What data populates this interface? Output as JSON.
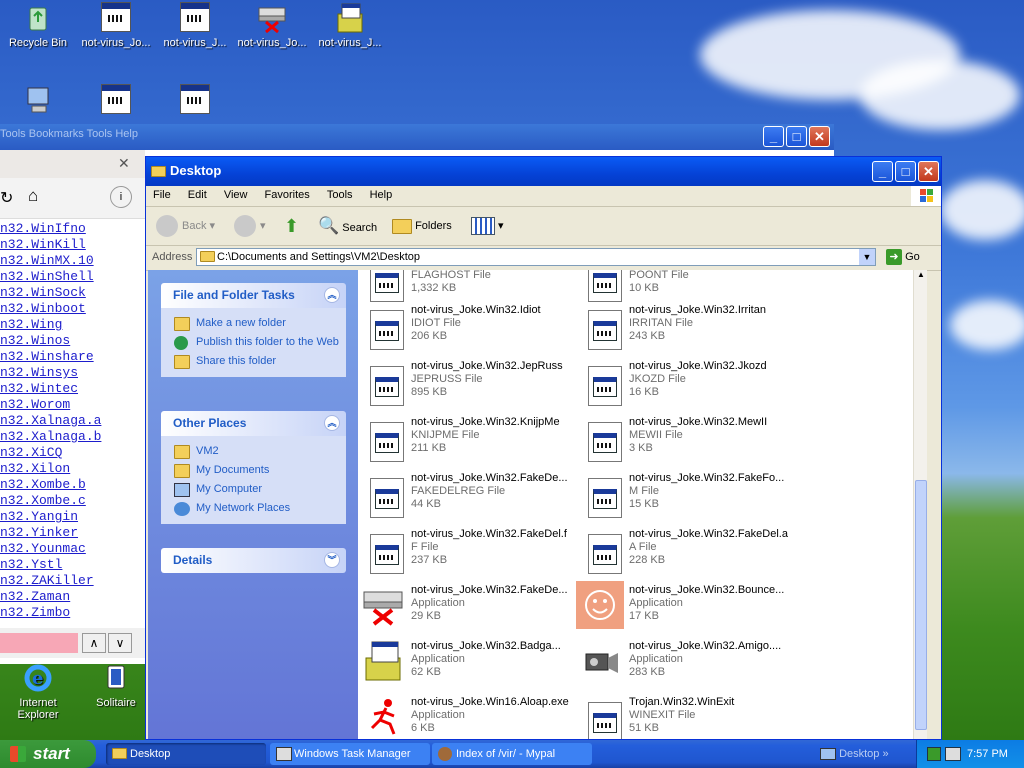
{
  "desktop": {
    "top_icons": [
      {
        "label": "Recycle Bin",
        "icon": "recycle-bin-icon"
      },
      {
        "label": "not-virus_Jo...",
        "icon": "exe-icon"
      },
      {
        "label": "not-virus_J...",
        "icon": "exe-icon"
      },
      {
        "label": "not-virus_Jo...",
        "icon": "network-x-icon"
      },
      {
        "label": "not-virus_J...",
        "icon": "installer-icon"
      }
    ],
    "bottom_icons": [
      {
        "label": "Internet Explorer",
        "icon": "ie-icon"
      },
      {
        "label": "Solitaire",
        "icon": "solitaire-icon"
      }
    ]
  },
  "bg_browser": {
    "faded_menu": "Tools   Bookmarks   Tools   Help",
    "links": [
      "n32.WinIfno",
      "n32.WinKill",
      "n32.WinMX.10",
      "n32.WinShell",
      "n32.WinSock",
      "n32.Winboot",
      "n32.Wing",
      "n32.Winos",
      "n32.Winshare",
      "n32.Winsys",
      "n32.Wintec",
      "n32.Worom",
      "n32.Xalnaga.a",
      "n32.Xalnaga.b",
      "n32.XiCQ",
      "n32.Xilon",
      "n32.Xombe.b",
      "n32.Xombe.c",
      "n32.Yangin",
      "n32.Yinker",
      "n32.Younmac",
      "n32.Ystl",
      "n32.ZAKiller",
      "n32.Zaman",
      "n32.Zimbo"
    ]
  },
  "explorer": {
    "title": "Desktop",
    "menu": [
      "File",
      "Edit",
      "View",
      "Favorites",
      "Tools",
      "Help"
    ],
    "toolbar": {
      "back": "Back",
      "search": "Search",
      "folders": "Folders"
    },
    "address": {
      "label": "Address",
      "path": "C:\\Documents and Settings\\VM2\\Desktop",
      "go": "Go"
    },
    "tasks_panel": {
      "title": "File and Folder Tasks",
      "items": [
        "Make a new folder",
        "Publish this folder to the Web",
        "Share this folder"
      ]
    },
    "places_panel": {
      "title": "Other Places",
      "items": [
        "VM2",
        "My Documents",
        "My Computer",
        "My Network Places"
      ]
    },
    "details_panel": {
      "title": "Details"
    },
    "files": [
      {
        "name": "",
        "type": "FLAGHOST File",
        "size": "1,332 KB",
        "icon": "doc"
      },
      {
        "name": "",
        "type": "POONT File",
        "size": "10 KB",
        "icon": "doc"
      },
      {
        "name": "not-virus_Joke.Win32.Idiot",
        "type": "IDIOT File",
        "size": "206 KB",
        "icon": "doc"
      },
      {
        "name": "not-virus_Joke.Win32.Irritan",
        "type": "IRRITAN File",
        "size": "243 KB",
        "icon": "doc"
      },
      {
        "name": "not-virus_Joke.Win32.JepRuss",
        "type": "JEPRUSS File",
        "size": "895 KB",
        "icon": "doc"
      },
      {
        "name": "not-virus_Joke.Win32.Jkozd",
        "type": "JKOZD File",
        "size": "16 KB",
        "icon": "doc"
      },
      {
        "name": "not-virus_Joke.Win32.KnijpMe",
        "type": "KNIJPME File",
        "size": "211 KB",
        "icon": "doc"
      },
      {
        "name": "not-virus_Joke.Win32.MewII",
        "type": "MEWII File",
        "size": "3 KB",
        "icon": "doc"
      },
      {
        "name": "not-virus_Joke.Win32.FakeDe...",
        "type": "FAKEDELREG File",
        "size": "44 KB",
        "icon": "doc"
      },
      {
        "name": "not-virus_Joke.Win32.FakeFo...",
        "type": "M File",
        "size": "15 KB",
        "icon": "doc"
      },
      {
        "name": "not-virus_Joke.Win32.FakeDel.f",
        "type": "F File",
        "size": "237 KB",
        "icon": "doc"
      },
      {
        "name": "not-virus_Joke.Win32.FakeDel.a",
        "type": "A File",
        "size": "228 KB",
        "icon": "doc"
      },
      {
        "name": "not-virus_Joke.Win32.FakeDe...",
        "type": "Application",
        "size": "29 KB",
        "icon": "network-x"
      },
      {
        "name": "not-virus_Joke.Win32.Bounce...",
        "type": "Application",
        "size": "17 KB",
        "icon": "smiley"
      },
      {
        "name": "not-virus_Joke.Win32.Badga...",
        "type": "Application",
        "size": "62 KB",
        "icon": "installer"
      },
      {
        "name": "not-virus_Joke.Win32.Amigo....",
        "type": "Application",
        "size": "283 KB",
        "icon": "camera"
      },
      {
        "name": "not-virus_Joke.Win16.Aloap.exe",
        "type": "Application",
        "size": "6 KB",
        "icon": "runner"
      },
      {
        "name": "Trojan.Win32.WinExit",
        "type": "WINEXIT File",
        "size": "51 KB",
        "icon": "doc"
      }
    ]
  },
  "taskbar": {
    "start": "start",
    "items": [
      "Desktop",
      "Windows Task Manager",
      "Index of /vir/ - Mypal"
    ],
    "quick_label": "Desktop",
    "clock": "7:57 PM"
  },
  "colors": {
    "title_blue": "#0542d6",
    "task_link": "#215dc6",
    "start_green": "#2e8b2e"
  }
}
